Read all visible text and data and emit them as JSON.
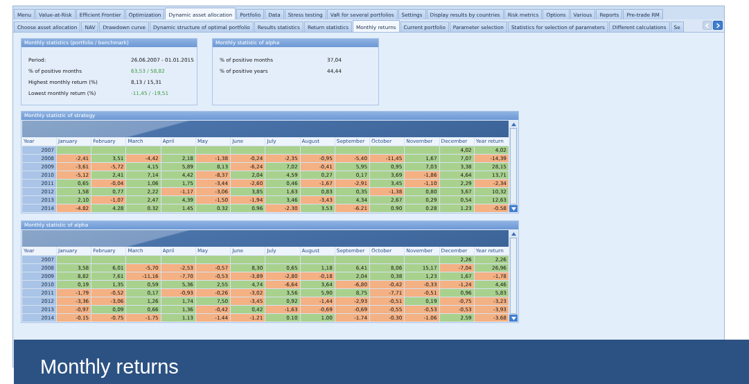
{
  "top_tabs": [
    {
      "label": "Menu",
      "selected": false
    },
    {
      "label": "Value-at-Risk",
      "selected": false
    },
    {
      "label": "Efficient Frontier",
      "selected": false
    },
    {
      "label": "Optimization",
      "selected": false
    },
    {
      "label": "Dynamic asset allocation",
      "selected": true
    },
    {
      "label": "Portfolio",
      "selected": false
    },
    {
      "label": "Data",
      "selected": false
    },
    {
      "label": "Stress testing",
      "selected": false
    },
    {
      "label": "VaR for several portfolios",
      "selected": false
    },
    {
      "label": "Settings",
      "selected": false
    },
    {
      "label": "Display results by countries",
      "selected": false
    },
    {
      "label": "Risk metrics",
      "selected": false
    },
    {
      "label": "Options",
      "selected": false
    },
    {
      "label": "Various",
      "selected": false
    },
    {
      "label": "Reports",
      "selected": false
    },
    {
      "label": "Pre-trade RM",
      "selected": false
    }
  ],
  "sub_tabs": [
    {
      "label": "Choose asset allocation",
      "selected": false
    },
    {
      "label": "NAV",
      "selected": false
    },
    {
      "label": "Drawdown curve",
      "selected": false
    },
    {
      "label": "Dynamic structure of optimal portfolio",
      "selected": false
    },
    {
      "label": "Results statistics",
      "selected": false
    },
    {
      "label": "Return statistics",
      "selected": false
    },
    {
      "label": "Monthly returns",
      "selected": true
    },
    {
      "label": "Current portfolio",
      "selected": false
    },
    {
      "label": "Parameter selection",
      "selected": false
    },
    {
      "label": "Statistics for selection of parameters",
      "selected": false
    },
    {
      "label": "Different calculations",
      "selected": false
    },
    {
      "label": "Se",
      "selected": false
    }
  ],
  "stats_panel": {
    "title": "Monthly statistics (portfolio / benchmark)",
    "rows": [
      {
        "label": "Period:",
        "value": "26.06.2007 - 01.01.2015",
        "highlighted": false
      },
      {
        "label": "% of positive months",
        "value": "63,53 / 58,82",
        "highlighted": true
      },
      {
        "label": "Highest monthly return (%)",
        "value": "8,13 / 15,31",
        "highlighted": false
      },
      {
        "label": "Lowest monthly return (%)",
        "value": "-11,45 / -19,51",
        "highlighted": true
      }
    ]
  },
  "alpha_panel": {
    "title": "Monthly statistic of alpha",
    "rows": [
      {
        "label": "% of positive months",
        "value": "37,04",
        "highlighted": false
      },
      {
        "label": "% of positive years",
        "value": "44,44",
        "highlighted": false
      }
    ]
  },
  "tables": [
    {
      "title": "Monthly statistic of strategy",
      "year_column": "Year",
      "columns": [
        "January",
        "February",
        "March",
        "April",
        "May",
        "June",
        "July",
        "August",
        "September",
        "October",
        "November",
        "December",
        "Year return"
      ],
      "rows": [
        {
          "year": "2007",
          "cells": [
            "",
            "",
            "",
            "",
            "",
            "",
            "",
            "",
            "",
            "",
            "",
            "4,02",
            "4,02"
          ],
          "negative": [
            false,
            false,
            false,
            false,
            false,
            false,
            false,
            false,
            false,
            false,
            false,
            false,
            false
          ]
        },
        {
          "year": "2008",
          "cells": [
            "-2,41",
            "3,51",
            "-4,42",
            "2,18",
            "-1,38",
            "-0,24",
            "-2,35",
            "-0,95",
            "-5,40",
            "-11,45",
            "1,67",
            "7,07",
            "-14,39"
          ],
          "negative": [
            true,
            false,
            true,
            false,
            true,
            true,
            true,
            true,
            true,
            true,
            false,
            false,
            true
          ]
        },
        {
          "year": "2009",
          "cells": [
            "-3,61",
            "-5,72",
            "4,15",
            "5,89",
            "8,13",
            "-6,24",
            "7,02",
            "-0,41",
            "5,95",
            "0,95",
            "7,03",
            "3,38",
            "28,15"
          ],
          "negative": [
            true,
            true,
            false,
            false,
            false,
            true,
            false,
            true,
            false,
            false,
            false,
            false,
            false
          ]
        },
        {
          "year": "2010",
          "cells": [
            "-5,12",
            "2,41",
            "7,14",
            "4,42",
            "-8,37",
            "2,04",
            "4,59",
            "0,27",
            "0,17",
            "3,69",
            "-1,86",
            "4,64",
            "13,71"
          ],
          "negative": [
            true,
            false,
            false,
            false,
            true,
            false,
            false,
            false,
            false,
            false,
            true,
            false,
            false
          ]
        },
        {
          "year": "2011",
          "cells": [
            "0,65",
            "-0,04",
            "1,06",
            "1,75",
            "-3,44",
            "-2,60",
            "0,46",
            "-1,67",
            "-2,91",
            "3,45",
            "-1,10",
            "2,29",
            "-2,34"
          ],
          "negative": [
            false,
            true,
            false,
            false,
            true,
            true,
            false,
            true,
            true,
            false,
            true,
            false,
            true
          ]
        },
        {
          "year": "2012",
          "cells": [
            "1,58",
            "0,77",
            "2,22",
            "-1,17",
            "-3,06",
            "3,85",
            "1,63",
            "0,83",
            "0,35",
            "-1,38",
            "0,80",
            "3,67",
            "10,32"
          ],
          "negative": [
            false,
            false,
            false,
            true,
            true,
            false,
            false,
            false,
            false,
            true,
            false,
            false,
            false
          ]
        },
        {
          "year": "2013",
          "cells": [
            "2,10",
            "-1,07",
            "2,47",
            "4,39",
            "-1,50",
            "-1,94",
            "3,46",
            "-3,43",
            "4,34",
            "2,67",
            "0,29",
            "0,54",
            "12,63"
          ],
          "negative": [
            false,
            true,
            false,
            false,
            true,
            true,
            false,
            true,
            false,
            false,
            false,
            false,
            false
          ]
        },
        {
          "year": "2014",
          "cells": [
            "-4.82",
            "4.28",
            "0.32",
            "1.45",
            "0.32",
            "0.96",
            "-2.30",
            "3.53",
            "-6.21",
            "0.90",
            "0.28",
            "1.23",
            "-0.58"
          ],
          "negative": [
            true,
            false,
            false,
            false,
            false,
            false,
            true,
            false,
            true,
            false,
            false,
            false,
            true
          ]
        }
      ]
    },
    {
      "title": "Monthly statistic of alpha",
      "year_column": "Year",
      "columns": [
        "January",
        "February",
        "March",
        "April",
        "May",
        "June",
        "July",
        "August",
        "September",
        "October",
        "November",
        "December",
        "Year return"
      ],
      "rows": [
        {
          "year": "2007",
          "cells": [
            "",
            "",
            "",
            "",
            "",
            "",
            "",
            "",
            "",
            "",
            "",
            "2,26",
            "2,26"
          ],
          "negative": [
            false,
            false,
            false,
            false,
            false,
            false,
            false,
            false,
            false,
            false,
            false,
            false,
            false
          ]
        },
        {
          "year": "2008",
          "cells": [
            "3,58",
            "6,01",
            "-5,70",
            "-2,53",
            "-0,57",
            "8,30",
            "0,65",
            "1,18",
            "6,41",
            "8,06",
            "15,17",
            "-7,04",
            "26,96"
          ],
          "negative": [
            false,
            false,
            true,
            true,
            true,
            false,
            false,
            false,
            false,
            false,
            false,
            true,
            false
          ]
        },
        {
          "year": "2009",
          "cells": [
            "8,82",
            "7,61",
            "-11,16",
            "-7,70",
            "-0,53",
            "-3,89",
            "-2,80",
            "-0,18",
            "2,04",
            "0,38",
            "1,23",
            "1,67",
            "-1,78"
          ],
          "negative": [
            false,
            false,
            true,
            true,
            true,
            true,
            true,
            true,
            false,
            false,
            false,
            false,
            true
          ]
        },
        {
          "year": "2010",
          "cells": [
            "0,19",
            "1,35",
            "0,59",
            "5,36",
            "2,55",
            "4,74",
            "-6,64",
            "3,64",
            "-6,80",
            "-0,42",
            "-0,33",
            "-1,24",
            "4,46"
          ],
          "negative": [
            false,
            false,
            false,
            false,
            false,
            false,
            true,
            false,
            true,
            true,
            true,
            true,
            false
          ]
        },
        {
          "year": "2011",
          "cells": [
            "-1,79",
            "-0,52",
            "0,17",
            "-0,93",
            "-0,26",
            "-3,02",
            "3,56",
            "5,90",
            "8,75",
            "-7,71",
            "-0,51",
            "0,96",
            "5,83"
          ],
          "negative": [
            true,
            true,
            false,
            true,
            true,
            true,
            false,
            false,
            false,
            true,
            true,
            false,
            false
          ]
        },
        {
          "year": "2012",
          "cells": [
            "-3,36",
            "-3,06",
            "1,26",
            "1,74",
            "7,50",
            "-3,45",
            "0,92",
            "-1,44",
            "-2,93",
            "-0,51",
            "0,19",
            "-0,75",
            "-3,23"
          ],
          "negative": [
            true,
            true,
            false,
            false,
            false,
            true,
            false,
            true,
            true,
            true,
            false,
            true,
            true
          ]
        },
        {
          "year": "2013",
          "cells": [
            "-0,97",
            "0,09",
            "0,66",
            "1,36",
            "-0,42",
            "0,42",
            "-1,63",
            "-0,69",
            "-0,69",
            "-0,55",
            "-0,53",
            "-0,53",
            "-3,93"
          ],
          "negative": [
            true,
            false,
            false,
            false,
            true,
            false,
            true,
            true,
            true,
            true,
            true,
            true,
            true
          ]
        },
        {
          "year": "2014",
          "cells": [
            "-0.15",
            "-0.75",
            "-1.75",
            "1.13",
            "-1.44",
            "-1.21",
            "0.10",
            "1.00",
            "-1.74",
            "-0.30",
            "-1.06",
            "2.59",
            "-3.68"
          ],
          "negative": [
            true,
            true,
            true,
            false,
            true,
            true,
            false,
            false,
            true,
            true,
            true,
            false,
            true
          ]
        }
      ]
    }
  ],
  "banner": {
    "title": "Monthly returns"
  }
}
